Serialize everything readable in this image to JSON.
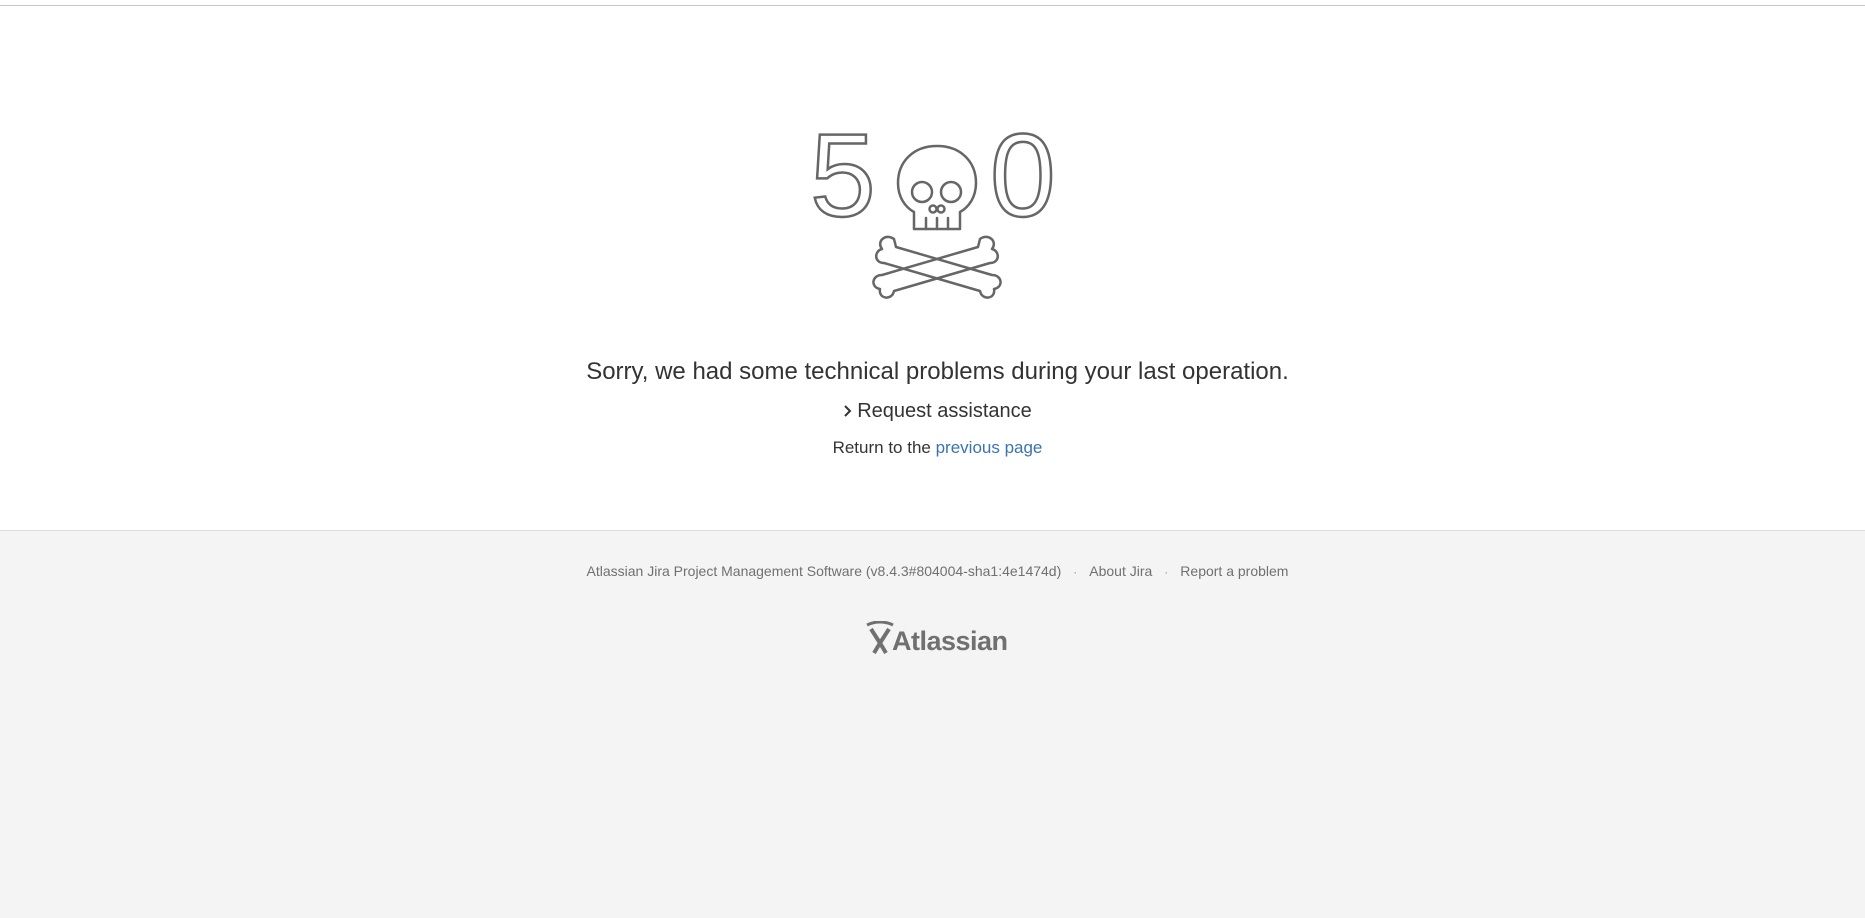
{
  "error": {
    "code_digits": [
      "5",
      "0"
    ],
    "message": "Sorry, we had some technical problems during your last operation.",
    "request_assistance": "Request assistance",
    "return_prefix": "Return to the",
    "return_link": "previous page"
  },
  "footer": {
    "software": "Atlassian Jira Project Management Software (v8.4.3#804004-sha1:4e1474d)",
    "separator": "·",
    "about": "About Jira",
    "report": "Report a problem",
    "logo_text": "Atlassian"
  },
  "colors": {
    "link": "#3b73af",
    "text": "#333333",
    "footer_bg": "#f4f4f4",
    "graphic_stroke": "#666666"
  }
}
